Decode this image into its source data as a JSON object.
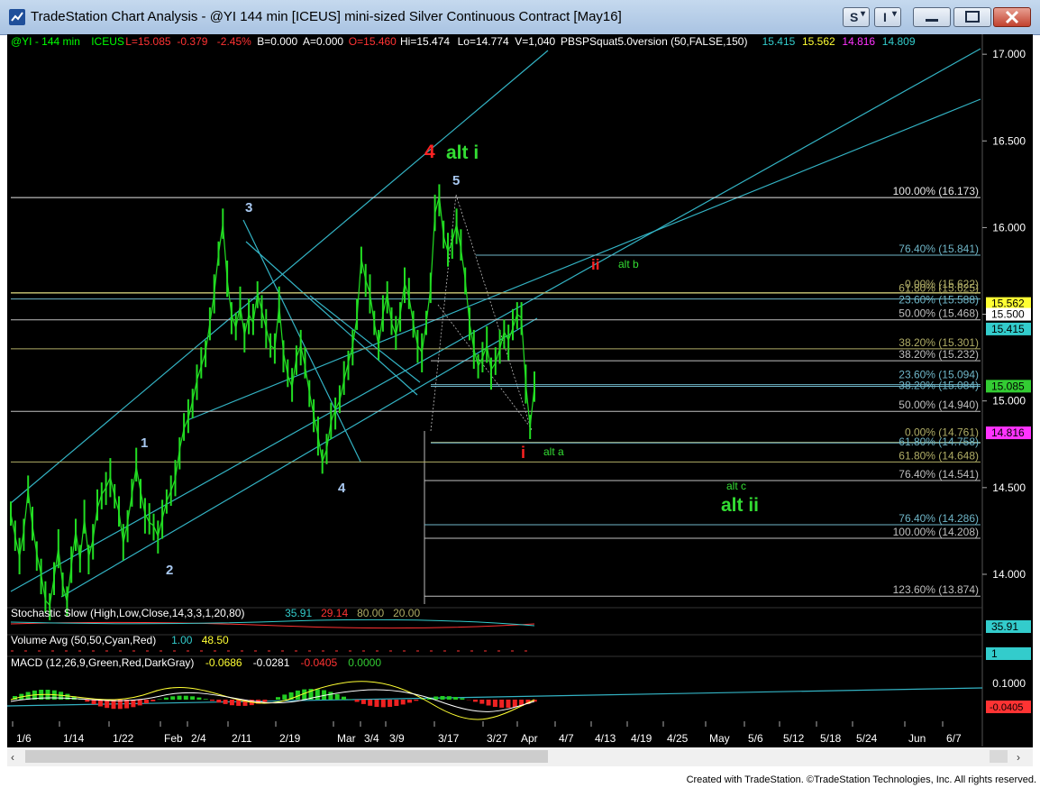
{
  "window": {
    "title": "TradeStation Chart Analysis - @YI 144 min [ICEUS] mini-sized Silver Continuous Contract [May16]",
    "buttons": {
      "s_label": "S",
      "i_label": "I"
    },
    "footer": "Created with TradeStation. ©TradeStation Technologies, Inc. All rights reserved."
  },
  "header": [
    {
      "text": "@YI - 144 min",
      "color": "#00ff00"
    },
    {
      "text": "ICEUS",
      "color": "#00ff00"
    },
    {
      "text": "L=15.085",
      "color": "#ff3333"
    },
    {
      "text": "-0.379",
      "color": "#ff3333"
    },
    {
      "text": "-2.45%",
      "color": "#ff3333"
    },
    {
      "text": "B=0.000",
      "color": "#ffffff"
    },
    {
      "text": "A=0.000",
      "color": "#ffffff"
    },
    {
      "text": "O=15.460",
      "color": "#ff3333"
    },
    {
      "text": "Hi=15.474",
      "color": "#ffffff"
    },
    {
      "text": "Lo=14.774",
      "color": "#ffffff"
    },
    {
      "text": "V=1,040",
      "color": "#ffffff"
    },
    {
      "text": "PBSPSquat5.0version (50,FALSE,150)",
      "color": "#ffffff"
    },
    {
      "text": "15.415",
      "color": "#33cccc"
    },
    {
      "text": "15.562",
      "color": "#ffff33"
    },
    {
      "text": "14.816",
      "color": "#ff33ff"
    },
    {
      "text": "14.809",
      "color": "#33cccc"
    }
  ],
  "chart_data": {
    "type": "line",
    "symbol": "@YI",
    "interval": "144 min",
    "ylim": [
      13.72,
      17.12
    ],
    "y_ticks": [
      "17.000",
      "16.500",
      "16.000",
      "15.500",
      "15.000",
      "14.500",
      "14.000"
    ],
    "x_ticks": [
      "1/6",
      "1/14",
      "1/22",
      "Feb",
      "2/4",
      "2/11",
      "2/19",
      "Mar",
      "3/4",
      "3/9",
      "3/17",
      "3/27",
      "Apr",
      "4/7",
      "4/13",
      "4/19",
      "4/25",
      "May",
      "5/6",
      "5/12",
      "5/18",
      "5/24",
      "Jun",
      "6/7"
    ],
    "series": [
      {
        "values": [
          14.35,
          14.22,
          14.1,
          14.25,
          14.48,
          14.28,
          14.12,
          14.0,
          13.85,
          13.82,
          13.98,
          14.15,
          13.94,
          13.84,
          14.05,
          14.25,
          14.08,
          14.32,
          14.1,
          14.2,
          14.38,
          14.46,
          14.5,
          14.56,
          14.45,
          14.36,
          14.18,
          14.3,
          14.46,
          14.62,
          14.48,
          14.35,
          14.3,
          14.28,
          14.22,
          14.32,
          14.42,
          14.48,
          14.55,
          14.72,
          14.84,
          14.9,
          15.0,
          15.12,
          15.2,
          15.28,
          15.45,
          15.62,
          15.85,
          16.02,
          15.7,
          15.5,
          15.42,
          15.55,
          15.38,
          15.5,
          15.45,
          15.62,
          15.52,
          15.42,
          15.32,
          15.3,
          15.55,
          15.28,
          15.15,
          15.08,
          15.25,
          15.32,
          15.2,
          15.05,
          14.92,
          14.8,
          14.65,
          14.72,
          14.88,
          14.95,
          15.0,
          15.12,
          15.22,
          15.32,
          15.48,
          15.82,
          15.7,
          15.62,
          15.45,
          15.32,
          15.5,
          15.62,
          15.45,
          15.38,
          15.5,
          15.68,
          15.6,
          15.45,
          15.32,
          15.28,
          15.45,
          15.65,
          16.08,
          16.18,
          15.95,
          15.86,
          15.92,
          16.02,
          15.88,
          15.7,
          15.45,
          15.3,
          15.2,
          15.25,
          15.32,
          15.18,
          15.22,
          15.3,
          15.4,
          15.35,
          15.42,
          15.5,
          15.48,
          15.1,
          14.85,
          15.08
        ]
      }
    ],
    "horizontal_levels": [
      {
        "label": "100.00% (16.173)",
        "value": 16.173,
        "color": "#e6e6e6"
      },
      {
        "label": "76.40% (15.841)",
        "value": 15.841,
        "color": "#6fb6c8"
      },
      {
        "label": "61.80% (15.625)",
        "value": 15.625,
        "color": "#b0ad66"
      },
      {
        "label": "0.00% (15.622)",
        "value": 15.622,
        "color": "#b0ad66"
      },
      {
        "label": "23.60% (15.588)",
        "value": 15.588,
        "color": "#6fb6c8"
      },
      {
        "label": "50.00% (15.468)",
        "value": 15.468,
        "color": "#bfbfbf"
      },
      {
        "label": "38.20% (15.301)",
        "value": 15.301,
        "color": "#b0ad66"
      },
      {
        "label": "38.20% (15.232)",
        "value": 15.232,
        "color": "#bfbfbf"
      },
      {
        "label": "23.60% (15.094)",
        "value": 15.094,
        "color": "#6fb6c8"
      },
      {
        "label": "38.20% (15.084)",
        "value": 15.084,
        "color": "#6fb6c8"
      },
      {
        "label": "50.00% (14.940)",
        "value": 14.94,
        "color": "#bfbfbf"
      },
      {
        "label": "0.00% (14.761)",
        "value": 14.761,
        "color": "#b0ad66"
      },
      {
        "label": "61.80% (14.758)",
        "value": 14.758,
        "color": "#6fb6c8"
      },
      {
        "label": "61.80% (14.648)",
        "value": 14.648,
        "color": "#b0ad66"
      },
      {
        "label": "76.40% (14.541)",
        "value": 14.541,
        "color": "#bfbfbf"
      },
      {
        "label": "76.40% (14.286)",
        "value": 14.286,
        "color": "#6fb6c8"
      },
      {
        "label": "100.00% (14.208)",
        "value": 14.208,
        "color": "#bfbfbf"
      },
      {
        "label": "123.60% (13.874)",
        "value": 13.874,
        "color": "#bfbfbf"
      }
    ],
    "price_markers": [
      {
        "label": "15.562",
        "value": 15.562,
        "bg": "#ffff33",
        "fg": "#000000"
      },
      {
        "label": "15.500",
        "value": 15.5,
        "bg": "#ffffff",
        "fg": "#000000"
      },
      {
        "label": "15.415",
        "value": 15.415,
        "bg": "#33cccc",
        "fg": "#000000"
      },
      {
        "label": "15.085",
        "value": 15.085,
        "bg": "#33cc33",
        "fg": "#000000"
      },
      {
        "label": "14.816",
        "value": 14.816,
        "bg": "#ff33ff",
        "fg": "#000000"
      }
    ],
    "annotations": [
      {
        "text": "1",
        "color": "#a8c8f0"
      },
      {
        "text": "2",
        "color": "#a8c8f0"
      },
      {
        "text": "3",
        "color": "#a8c8f0"
      },
      {
        "text": "4",
        "color": "#a8c8f0"
      },
      {
        "text": "5",
        "color": "#a8c8f0"
      },
      {
        "text": "4",
        "color": "#ff2222"
      },
      {
        "text": "alt i",
        "color": "#33dd33"
      },
      {
        "text": "ii",
        "color": "#ff2222"
      },
      {
        "text": "alt b",
        "color": "#33dd33"
      },
      {
        "text": "i",
        "color": "#ff2222"
      },
      {
        "text": "alt a",
        "color": "#33dd33"
      },
      {
        "text": "alt c",
        "color": "#33dd33"
      },
      {
        "text": "alt ii",
        "color": "#33dd33"
      }
    ]
  },
  "indicators": {
    "stochastic": {
      "label": "Stochastic Slow (High,Low,Close,14,3,3,1,20,80)",
      "values": [
        {
          "text": "35.91",
          "color": "#33cccc"
        },
        {
          "text": "29.14",
          "color": "#ff3333"
        },
        {
          "text": "80.00",
          "color": "#b0ad66"
        },
        {
          "text": "20.00",
          "color": "#b0ad66"
        }
      ],
      "axis_label": "35.91"
    },
    "volume": {
      "label": "Volume Avg (50,50,Cyan,Red)",
      "values": [
        {
          "text": "1.00",
          "color": "#33cccc"
        },
        {
          "text": "48.50",
          "color": "#ffff33"
        }
      ],
      "axis_label": "1"
    },
    "macd": {
      "label": "MACD (12,26,9,Green,Red,DarkGray)",
      "values": [
        {
          "text": "-0.0686",
          "color": "#ffff33"
        },
        {
          "text": "-0.0281",
          "color": "#ffffff"
        },
        {
          "text": "-0.0405",
          "color": "#ff3333"
        },
        {
          "text": "0.0000",
          "color": "#33cc33"
        }
      ],
      "axis_labels": [
        "0.1000",
        "-0.0405"
      ]
    }
  }
}
